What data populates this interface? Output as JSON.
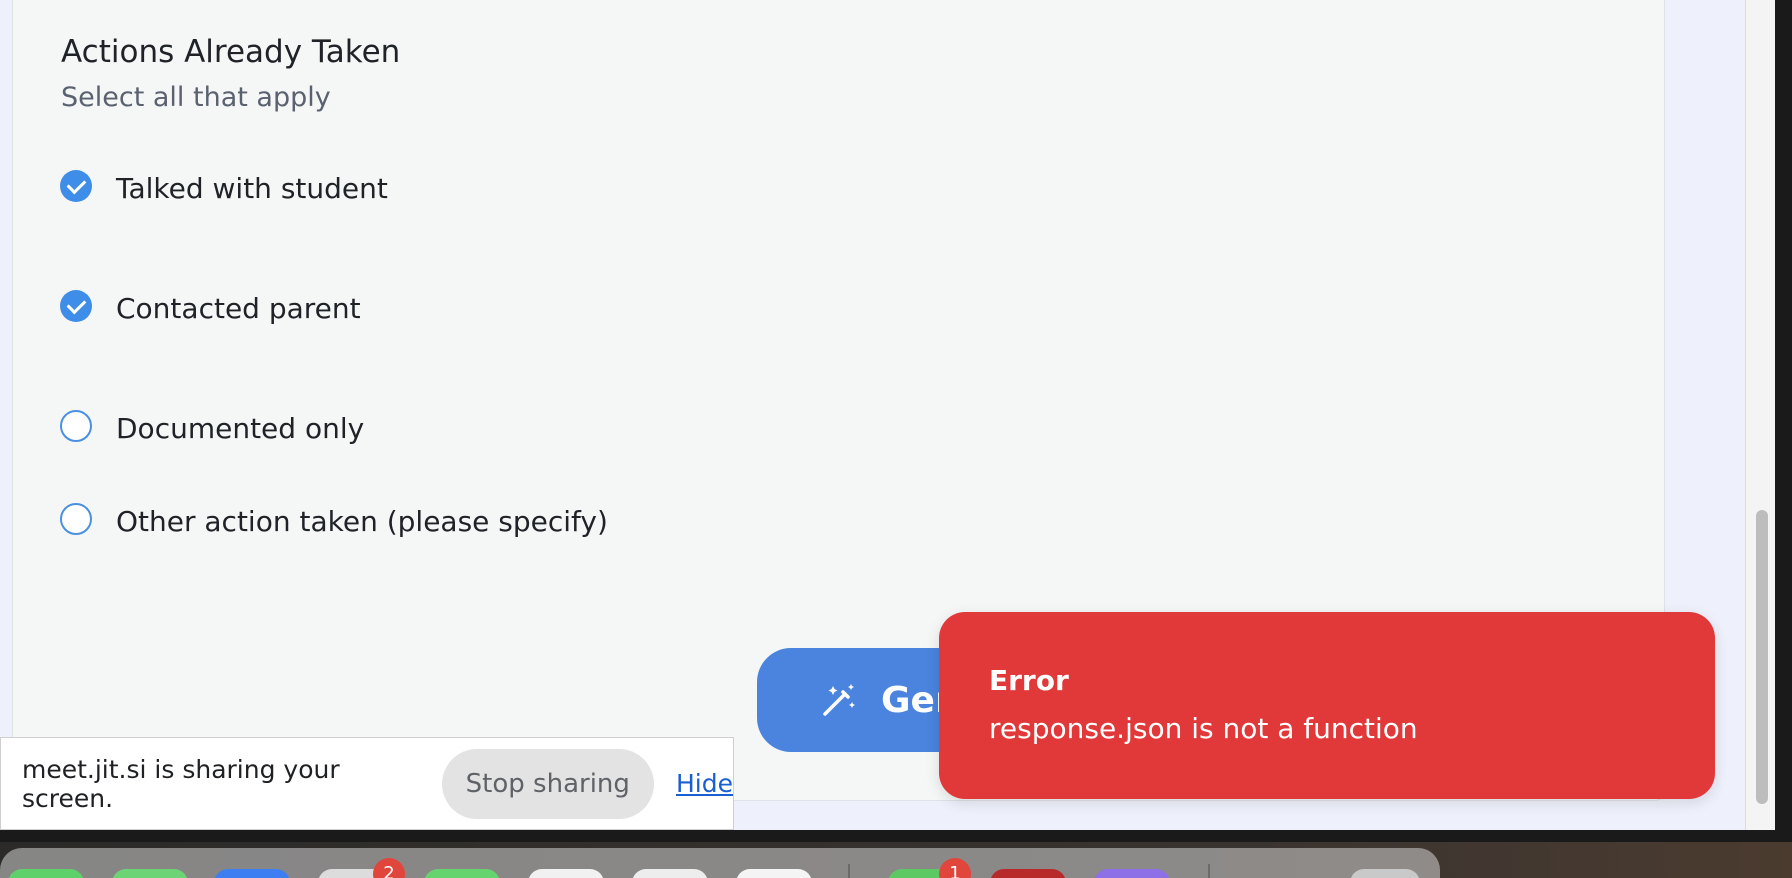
{
  "section": {
    "title": "Actions Already Taken",
    "subtitle": "Select all that apply"
  },
  "options": [
    {
      "label": "Talked with student",
      "checked": true
    },
    {
      "label": "Contacted parent",
      "checked": true
    },
    {
      "label": "Documented only",
      "checked": false
    },
    {
      "label": "Other action taken (please specify)",
      "checked": false
    }
  ],
  "generate_button": {
    "label": "Gen",
    "icon": "magic-wand-icon"
  },
  "toast": {
    "title": "Error",
    "message": "response.json is not a function",
    "color": "#e1393a"
  },
  "share_bar": {
    "text": "meet.jit.si is sharing your screen.",
    "stop_label": "Stop sharing",
    "hide_label": "Hide"
  },
  "dock": {
    "badges": [
      "2",
      "1"
    ]
  },
  "colors": {
    "accent": "#3e8ee9",
    "button": "#4a84de",
    "error": "#e1393a"
  }
}
